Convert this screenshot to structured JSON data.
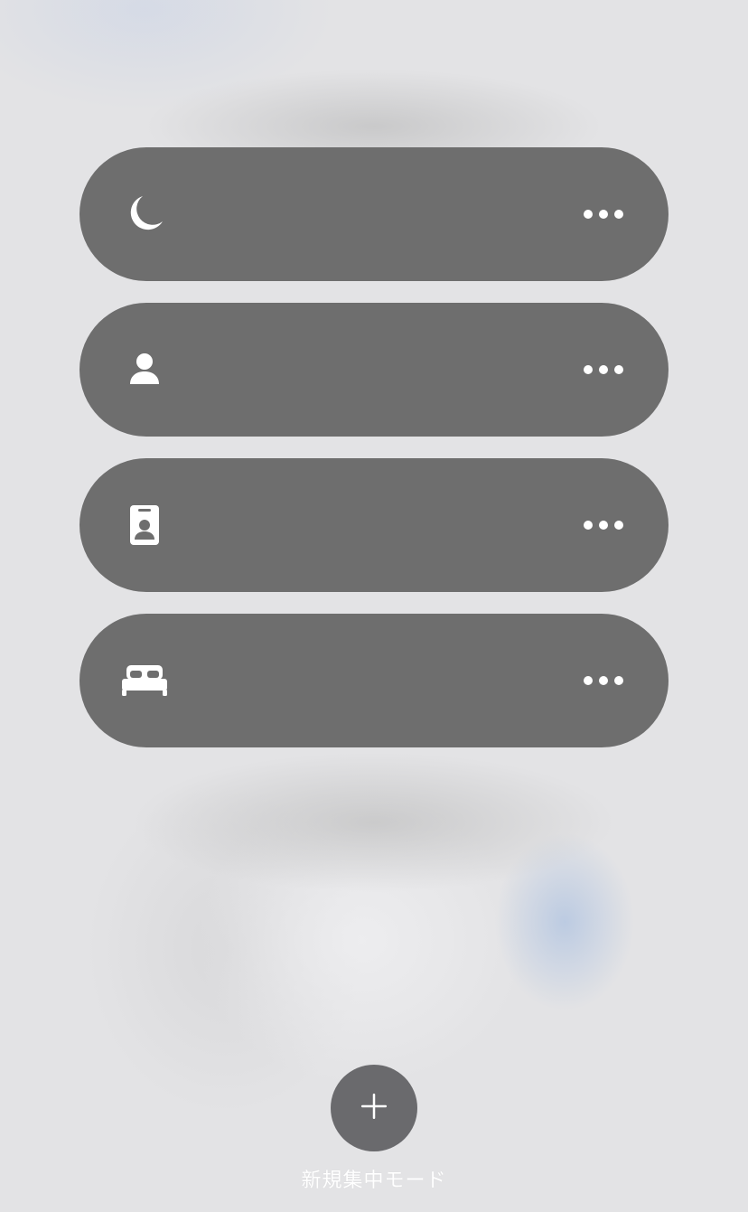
{
  "focus_modes": [
    {
      "icon": "moon-icon",
      "more": "more-icon"
    },
    {
      "icon": "person-icon",
      "more": "more-icon"
    },
    {
      "icon": "id-badge-icon",
      "more": "more-icon"
    },
    {
      "icon": "bed-icon",
      "more": "more-icon"
    }
  ],
  "add_focus": {
    "icon": "plus-icon",
    "label": "新規集中モード"
  },
  "colors": {
    "item_background": "#6e6e6e",
    "add_button_background": "#6a6a6d",
    "icon": "#ffffff"
  }
}
